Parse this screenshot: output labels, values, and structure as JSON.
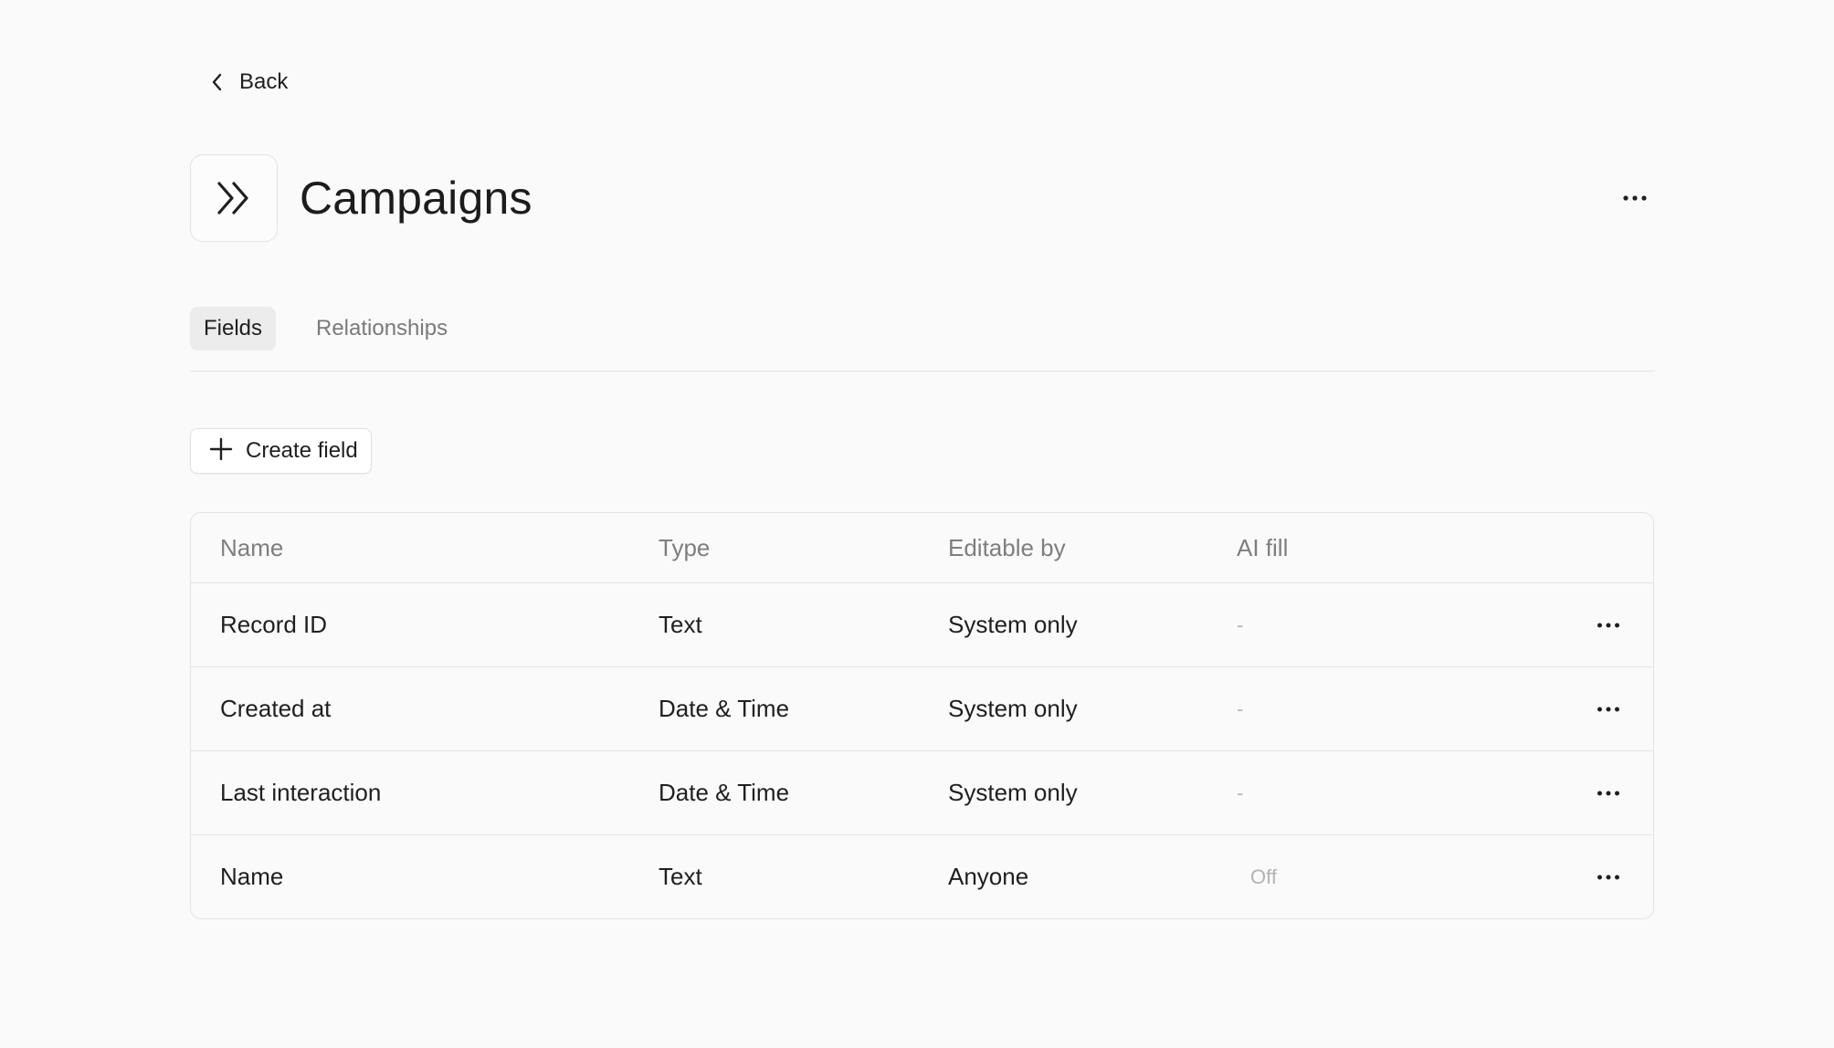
{
  "nav": {
    "back_label": "Back",
    "back_icon": "chevron-left-icon"
  },
  "header": {
    "title": "Campaigns",
    "object_icon": "double-chevron-right-icon",
    "more_icon": "more-horizontal-icon"
  },
  "tabs": [
    {
      "label": "Fields",
      "active": true
    },
    {
      "label": "Relationships",
      "active": false
    }
  ],
  "actions": {
    "create_field_label": "Create field",
    "create_field_icon": "plus-icon"
  },
  "table": {
    "columns": [
      "Name",
      "Type",
      "Editable by",
      "AI fill"
    ],
    "rows": [
      {
        "name": "Record ID",
        "type": "Text",
        "editable_by": "System only",
        "ai_fill": "-"
      },
      {
        "name": "Created at",
        "type": "Date & Time",
        "editable_by": "System only",
        "ai_fill": "-"
      },
      {
        "name": "Last interaction",
        "type": "Date & Time",
        "editable_by": "System only",
        "ai_fill": "-"
      },
      {
        "name": "Name",
        "type": "Text",
        "editable_by": "Anyone",
        "ai_fill": "Off"
      }
    ]
  },
  "colors": {
    "background": "#fafafa",
    "border": "#e4e4e4",
    "text_primary": "#1f1f1f",
    "text_muted": "#7e7e7e",
    "active_tab_bg": "#ececec"
  }
}
